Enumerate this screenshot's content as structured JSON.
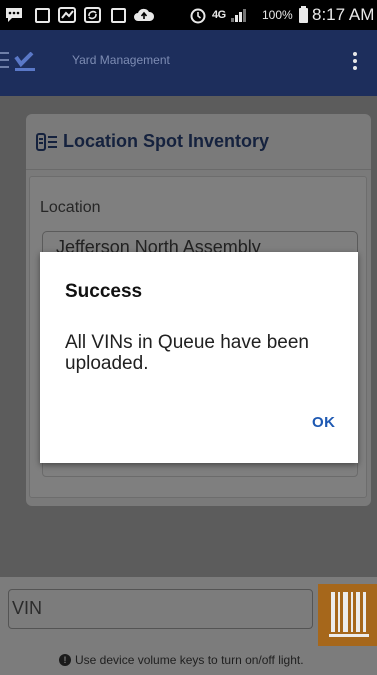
{
  "status_bar": {
    "battery_percent": "100%",
    "time": "8:17 AM",
    "network": "4G"
  },
  "app_bar": {
    "title": "Yard Management"
  },
  "panel": {
    "title": "Location Spot Inventory",
    "location_label": "Location",
    "location_value": "Jefferson North Assembly"
  },
  "dialog": {
    "title": "Success",
    "message": "All VINs in Queue have been uploaded.",
    "ok_label": "OK"
  },
  "bottom": {
    "vin_placeholder": "VIN",
    "hint": "Use device volume keys to turn on/off light."
  },
  "colors": {
    "appbar": "#1d2e5c",
    "scan_button": "#a6671b",
    "accent_ok": "#1d58b2"
  }
}
